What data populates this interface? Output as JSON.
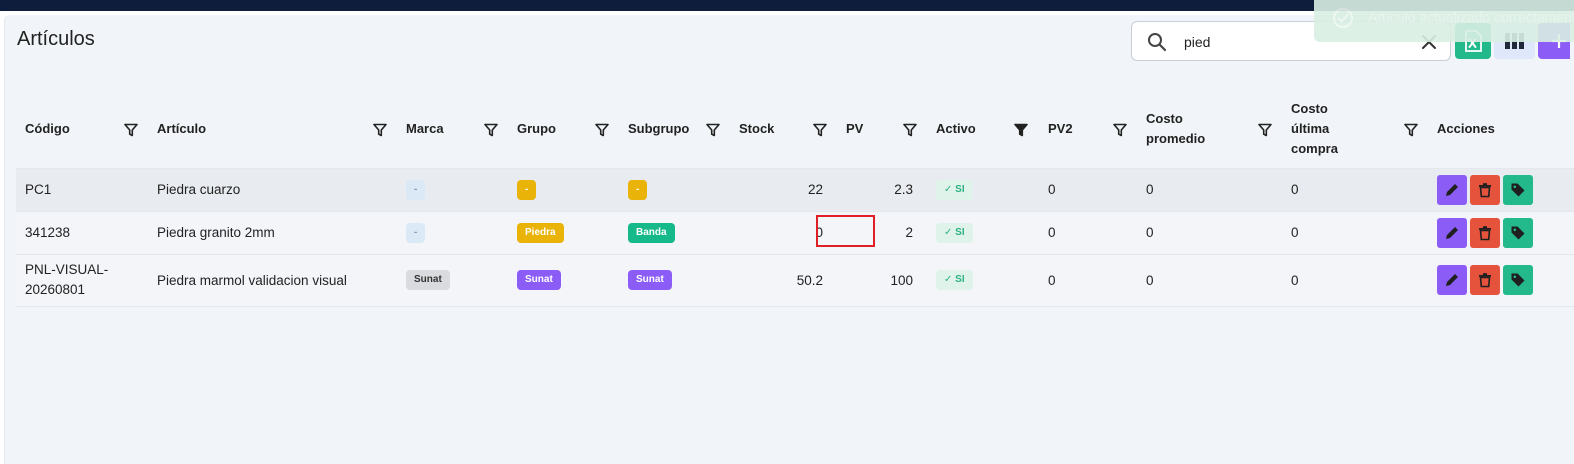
{
  "page": {
    "title": "Artículos"
  },
  "search": {
    "value": "pied",
    "placeholder": ""
  },
  "toast": {
    "message": "Artículo actualizado correctamente"
  },
  "columns": [
    {
      "key": "codigo",
      "label": "Código"
    },
    {
      "key": "articulo",
      "label": "Artículo"
    },
    {
      "key": "marca",
      "label": "Marca"
    },
    {
      "key": "grupo",
      "label": "Grupo"
    },
    {
      "key": "subgrupo",
      "label": "Subgrupo"
    },
    {
      "key": "stock",
      "label": "Stock"
    },
    {
      "key": "pv",
      "label": "PV"
    },
    {
      "key": "activo",
      "label": "Activo"
    },
    {
      "key": "pv2",
      "label": "PV2"
    },
    {
      "key": "costo_promedio",
      "label": "Costo promedio",
      "lines": [
        "Costo",
        "promedio"
      ]
    },
    {
      "key": "costo_ultima",
      "label": "Costo última compra",
      "lines": [
        "Costo",
        "última",
        "compra"
      ]
    },
    {
      "key": "acciones",
      "label": "Acciones"
    }
  ],
  "rows": [
    {
      "codigo": "PC1",
      "articulo": "Piedra cuarzo",
      "marca": "-",
      "grupo": "-",
      "subgrupo": "-",
      "stock": "22",
      "pv": "2.3",
      "activo": "SI",
      "pv2": "0",
      "costo_promedio": "0",
      "costo_ultima": "0"
    },
    {
      "codigo": "341238",
      "articulo": "Piedra granito 2mm",
      "marca": "-",
      "grupo": "Piedra",
      "subgrupo": "Banda",
      "stock": "0",
      "pv": "2",
      "activo": "SI",
      "pv2": "0",
      "costo_promedio": "0",
      "costo_ultima": "0"
    },
    {
      "codigo": "PNL-VISUAL-20260801",
      "articulo": "Piedra marmol validacion visual",
      "marca": "Sunat",
      "grupo": "Sunat",
      "subgrupo": "Sunat",
      "stock": "50.2",
      "pv": "100",
      "activo": "SI",
      "pv2": "0",
      "costo_promedio": "0",
      "costo_ultima": "0"
    }
  ],
  "icons": {
    "search": "search-icon",
    "clear": "close-icon",
    "excel": "excel-icon",
    "columns": "columns-icon",
    "add": "plus-icon",
    "filter": "filter-icon",
    "edit": "pencil-icon",
    "delete": "trash-icon",
    "tag": "tag-icon",
    "check": "check-icon"
  },
  "colors": {
    "topbar": "#0f1d3d",
    "excel": "#23b98a",
    "add": "#8b5cf6",
    "edit": "#8b5cf6",
    "delete": "#e5533d",
    "tag": "#23b98a",
    "highlight": "#e01e26"
  }
}
